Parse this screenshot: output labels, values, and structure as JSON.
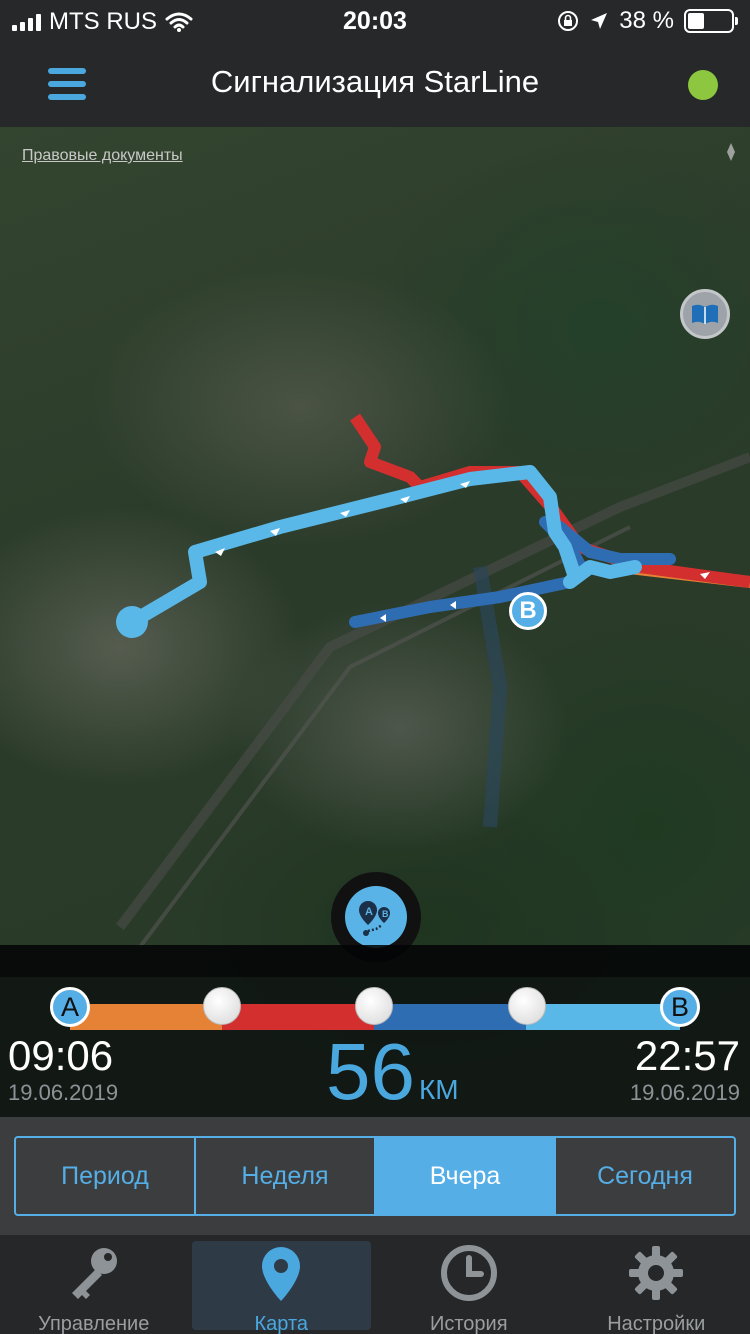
{
  "status_bar": {
    "carrier": "MTS RUS",
    "time": "20:03",
    "battery_percent": "38 %",
    "battery_level": 0.38
  },
  "header": {
    "title": "Сигнализация StarLine",
    "connection_status_color": "#8dc63f",
    "menu_icon": "hamburger-menu-icon"
  },
  "map": {
    "legal_link": "Правовые документы",
    "point_b_label": "B",
    "track_colors": {
      "segment_1": "#e58236",
      "segment_2": "#d32f2f",
      "segment_3": "#2f6db3",
      "segment_4": "#5ab8e8"
    },
    "book_button_icon": "map-book-icon",
    "route_button_icon": "route-ab-icon"
  },
  "route": {
    "start_label": "A",
    "end_label": "B",
    "start_time": "09:06",
    "start_date": "19.06.2019",
    "end_time": "22:57",
    "end_date": "19.06.2019",
    "distance": "56",
    "distance_unit": "КМ"
  },
  "period_tabs": [
    {
      "label": "Период",
      "active": false
    },
    {
      "label": "Неделя",
      "active": false
    },
    {
      "label": "Вчера",
      "active": true
    },
    {
      "label": "Сегодня",
      "active": false
    }
  ],
  "tab_bar": [
    {
      "label": "Управление",
      "icon": "key-icon",
      "active": false
    },
    {
      "label": "Карта",
      "icon": "map-pin-icon",
      "active": true
    },
    {
      "label": "История",
      "icon": "clock-icon",
      "active": false
    },
    {
      "label": "Настройки",
      "icon": "gear-icon",
      "active": false
    }
  ]
}
